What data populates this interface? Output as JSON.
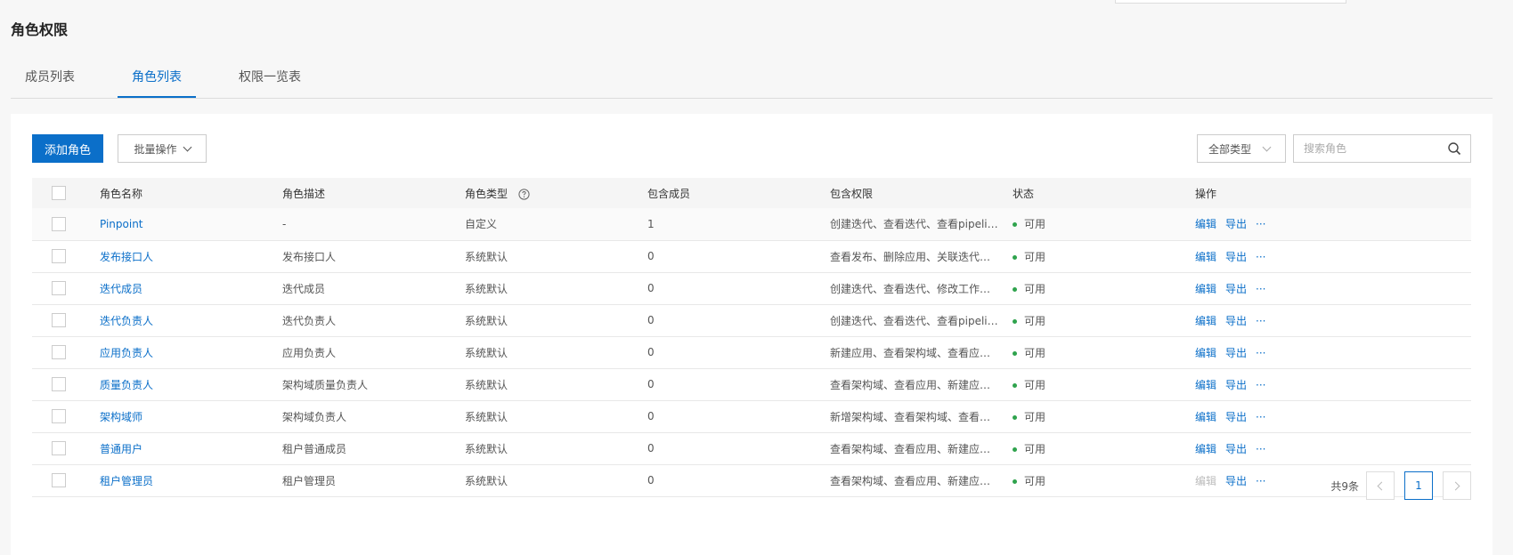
{
  "page": {
    "title": "角色权限"
  },
  "tabs": [
    {
      "label": "成员列表",
      "active": false
    },
    {
      "label": "角色列表",
      "active": true
    },
    {
      "label": "权限一览表",
      "active": false
    }
  ],
  "toolbar": {
    "add_label": "添加角色",
    "batch_label": "批量操作",
    "type_filter_value": "全部类型",
    "search_placeholder": "搜索角色",
    "search_value": ""
  },
  "table": {
    "headers": [
      "角色名称",
      "角色描述",
      "角色类型",
      "包含成员",
      "包含权限",
      "状态",
      "操作"
    ],
    "rows": [
      {
        "name": "Pinpoint",
        "desc": "-",
        "type": "自定义",
        "members": "1",
        "perms": "创建迭代、查看迭代、查看pipeline、…",
        "status": "可用",
        "edit": "编辑",
        "edit_disabled": false,
        "export": "导出",
        "more": "···"
      },
      {
        "name": "发布接口人",
        "desc": "发布接口人",
        "type": "系统默认",
        "members": "0",
        "perms": "查看发布、删除应用、关联迭代、…",
        "status": "可用",
        "edit": "编辑",
        "edit_disabled": false,
        "export": "导出",
        "more": "···"
      },
      {
        "name": "迭代成员",
        "desc": "迭代成员",
        "type": "系统默认",
        "members": "0",
        "perms": "创建迭代、查看迭代、修改工作项…",
        "status": "可用",
        "edit": "编辑",
        "edit_disabled": false,
        "export": "导出",
        "more": "···"
      },
      {
        "name": "迭代负责人",
        "desc": "迭代负责人",
        "type": "系统默认",
        "members": "0",
        "perms": "创建迭代、查看迭代、查看pipeline、…",
        "status": "可用",
        "edit": "编辑",
        "edit_disabled": false,
        "export": "导出",
        "more": "···"
      },
      {
        "name": "应用负责人",
        "desc": "应用负责人",
        "type": "系统默认",
        "members": "0",
        "perms": "新建应用、查看架构域、查看应用…",
        "status": "可用",
        "edit": "编辑",
        "edit_disabled": false,
        "export": "导出",
        "more": "···"
      },
      {
        "name": "质量负责人",
        "desc": "架构域质量负责人",
        "type": "系统默认",
        "members": "0",
        "perms": "查看架构域、查看应用、新建应用…",
        "status": "可用",
        "edit": "编辑",
        "edit_disabled": false,
        "export": "导出",
        "more": "···"
      },
      {
        "name": "架构域师",
        "desc": "架构域负责人",
        "type": "系统默认",
        "members": "0",
        "perms": "新增架构域、查看架构域、查看应…",
        "status": "可用",
        "edit": "编辑",
        "edit_disabled": false,
        "export": "导出",
        "more": "···"
      },
      {
        "name": "普通用户",
        "desc": "租户普通成员",
        "type": "系统默认",
        "members": "0",
        "perms": "查看架构域、查看应用、新建应用…",
        "status": "可用",
        "edit": "编辑",
        "edit_disabled": false,
        "export": "导出",
        "more": "···"
      },
      {
        "name": "租户管理员",
        "desc": "租户管理员",
        "type": "系统默认",
        "members": "0",
        "perms": "查看架构域、查看应用、新建应用…",
        "status": "可用",
        "edit": "编辑",
        "edit_disabled": true,
        "export": "导出",
        "more": "···"
      }
    ]
  },
  "pagination": {
    "total_text": "共9条",
    "current_page": "1"
  },
  "colors": {
    "accent": "#0b6fc9",
    "status_ok": "#2fa34d",
    "disabled": "#bbbbbb"
  },
  "icons": [
    "search-icon",
    "help-circle-icon",
    "chevron-down-icon",
    "chevron-left-icon",
    "chevron-right-icon",
    "status-dot-icon",
    "more-icon"
  ]
}
